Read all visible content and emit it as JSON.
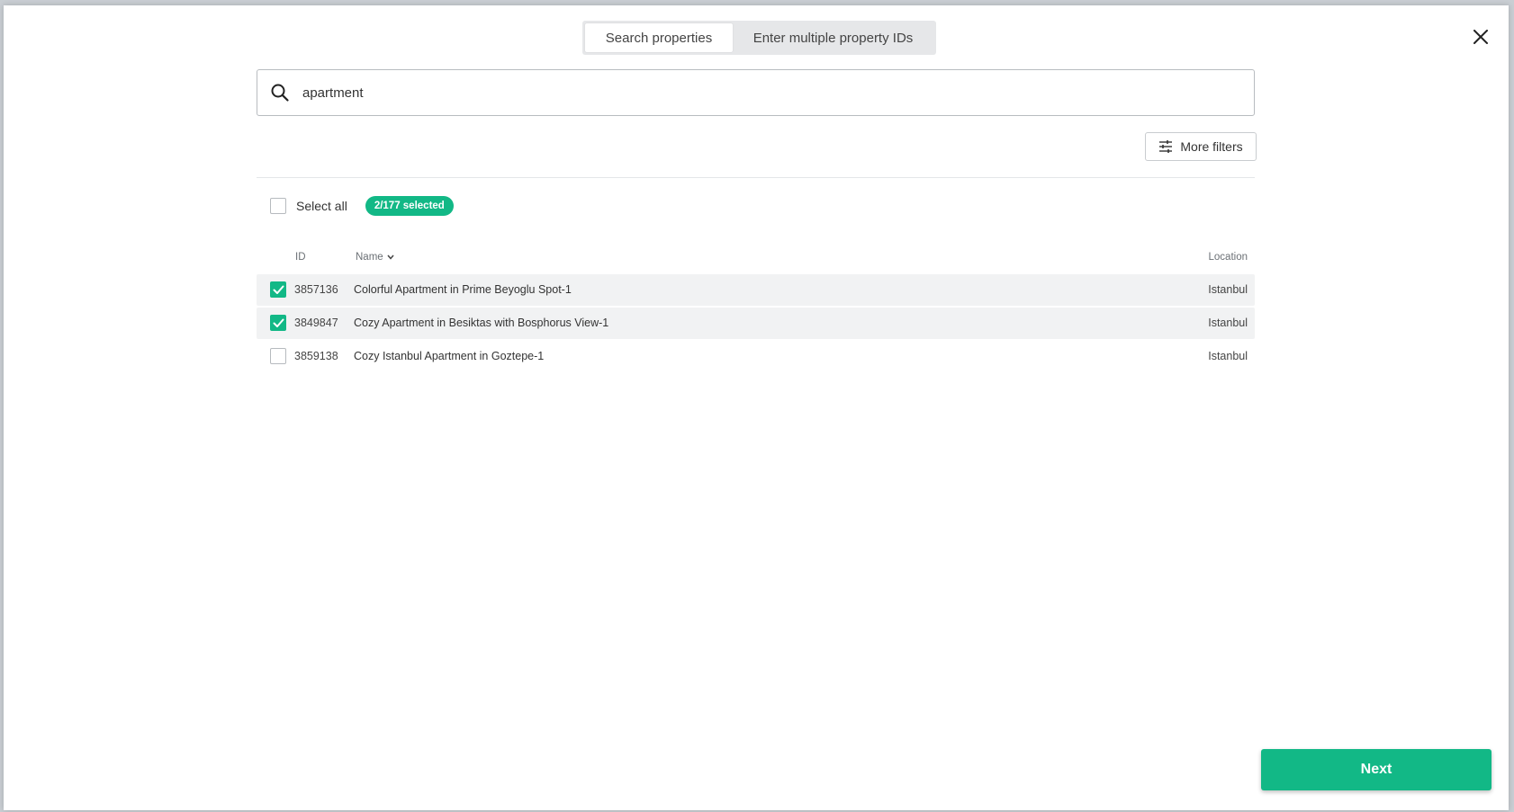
{
  "tabs": [
    {
      "label": "Search properties",
      "active": true
    },
    {
      "label": "Enter multiple property IDs",
      "active": false
    }
  ],
  "search": {
    "value": "apartment",
    "icon": "search-icon"
  },
  "filters": {
    "more_filters_label": "More filters",
    "icon": "sliders-icon"
  },
  "selection": {
    "select_all_label": "Select all",
    "select_all_checked": false,
    "badge": "2/177 selected"
  },
  "table": {
    "columns": {
      "id": "ID",
      "name": "Name",
      "location": "Location"
    },
    "rows": [
      {
        "id": "3857136",
        "name": "Colorful Apartment in Prime Beyoglu Spot-1",
        "location": "Istanbul",
        "checked": true
      },
      {
        "id": "3849847",
        "name": "Cozy Apartment in Besiktas with Bosphorus View-1",
        "location": "Istanbul",
        "checked": true
      },
      {
        "id": "3859138",
        "name": "Cozy Istanbul Apartment in Goztepe-1",
        "location": "Istanbul",
        "checked": false
      }
    ]
  },
  "footer": {
    "next_label": "Next"
  },
  "colors": {
    "accent": "#12b886",
    "selected_row": "#f1f2f3"
  }
}
